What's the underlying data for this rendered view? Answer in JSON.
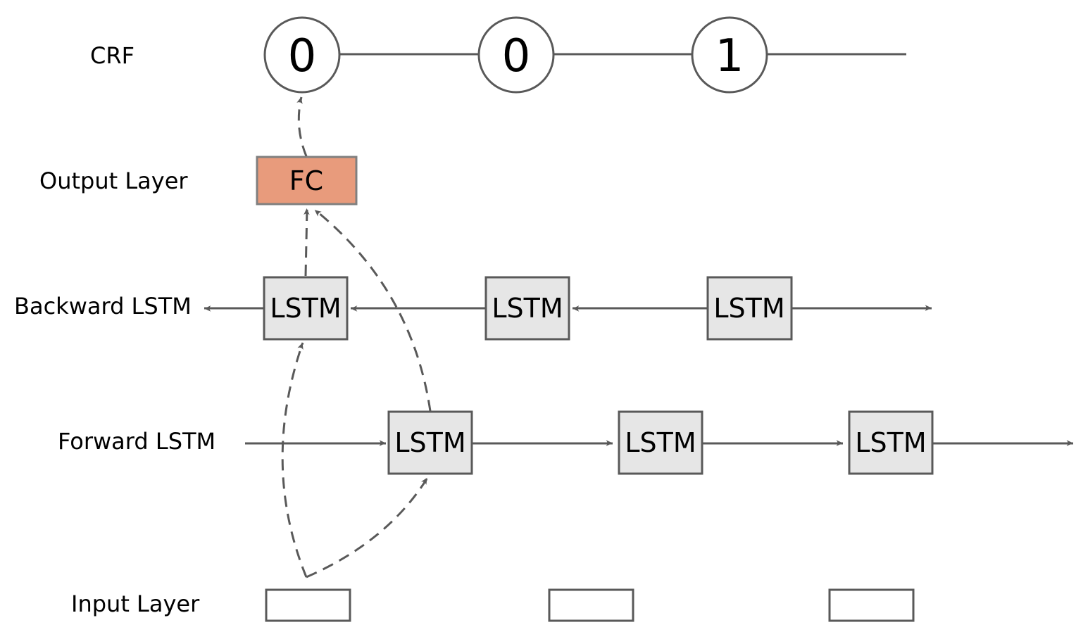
{
  "row_labels": {
    "crf": "CRF",
    "output": "Output Layer",
    "backward": "Backward LSTM",
    "forward": "Forward LSTM",
    "input": "Input Layer"
  },
  "crf_nodes": [
    "0",
    "0",
    "1"
  ],
  "fc_label": "FC",
  "backward_cells": [
    "LSTM",
    "LSTM",
    "LSTM"
  ],
  "forward_cells": [
    "LSTM",
    "LSTM",
    "LSTM"
  ],
  "colors": {
    "fc_fill": "#E89B7C",
    "cell_fill": "#E6E6E6",
    "line": "#595959"
  }
}
